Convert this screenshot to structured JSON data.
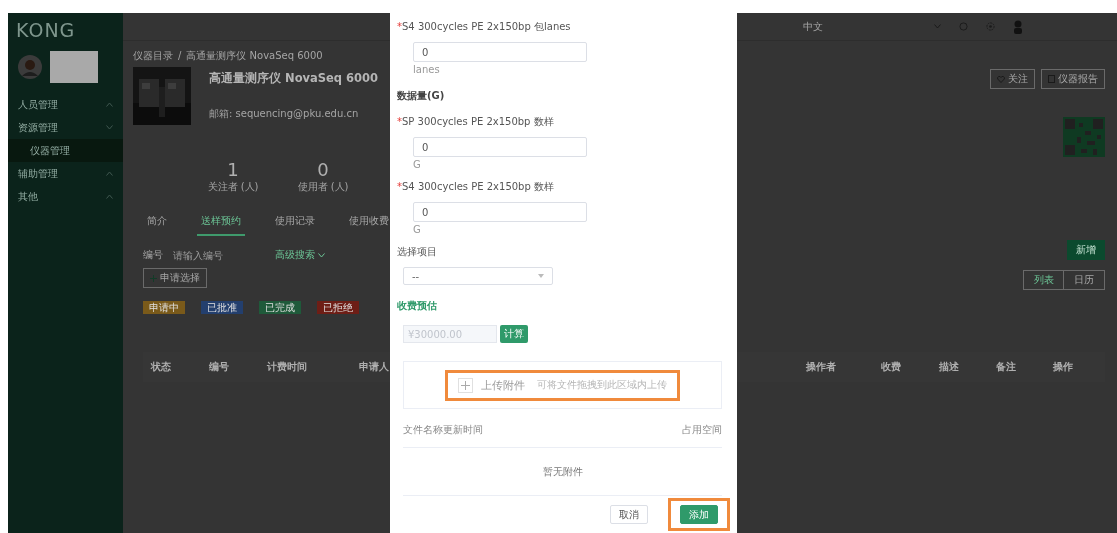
{
  "sidebar": {
    "logo": "KONG",
    "items": [
      {
        "label": "人员管理",
        "expanded": false,
        "selected": false
      },
      {
        "label": "资源管理",
        "expanded": true,
        "selected": false,
        "children": [
          {
            "label": "仪器管理",
            "selected": true
          }
        ]
      },
      {
        "label": "辅助管理",
        "expanded": false,
        "selected": false
      },
      {
        "label": "其他",
        "expanded": false,
        "selected": false
      }
    ]
  },
  "header": {
    "language": "中文"
  },
  "device": {
    "breadcrumb": [
      "仪器目录",
      "/",
      "高通量测序仪 NovaSeq 6000"
    ],
    "title": "高通量测序仪 NovaSeq 6000",
    "email": "邮箱: sequencing@pku.edu.cn",
    "stats": [
      {
        "value": "1",
        "label": "关注者 (人)"
      },
      {
        "value": "0",
        "label": "使用者 (人)"
      }
    ],
    "actions": [
      "关注",
      "仪器报告"
    ]
  },
  "tabs": [
    {
      "label": "简介",
      "selected": false
    },
    {
      "label": "送样预约",
      "selected": true
    },
    {
      "label": "使用记录",
      "selected": false
    },
    {
      "label": "使用收费",
      "selected": false
    }
  ],
  "filter": {
    "label": "编号",
    "placeholder": "请输入编号",
    "advanced": "高级搜索"
  },
  "batch_button": "申请选择",
  "status_tags": [
    {
      "label": "申请中",
      "color": "#7a5a1a"
    },
    {
      "label": "已批准",
      "color": "#233f6e"
    },
    {
      "label": "已完成",
      "color": "#1f5a3a"
    },
    {
      "label": "已拒绝",
      "color": "#6e1e16"
    }
  ],
  "new_button": "新增",
  "view_toggle": [
    {
      "label": "列表",
      "selected": true
    },
    {
      "label": "日历",
      "selected": false
    }
  ],
  "table": {
    "columns_left": [
      "状态",
      "编号",
      "计费时间",
      "申请人"
    ],
    "columns_right": [
      "操作者",
      "收费",
      "描述",
      "备注",
      "操作"
    ]
  },
  "modal": {
    "fields": [
      {
        "kind": "number",
        "required": "*",
        "label": "S4 300cycles PE 2x150bp 包lanes",
        "value": "0",
        "unit": "lanes"
      },
      {
        "kind": "section",
        "label": "数据量(G)"
      },
      {
        "kind": "number",
        "required": "*",
        "label": "SP 300cycles PE 2x150bp 数样",
        "value": "0",
        "unit": "G"
      },
      {
        "kind": "number",
        "required": "*",
        "label": "S4 300cycles PE 2x150bp 数样",
        "value": "0",
        "unit": "G"
      },
      {
        "kind": "select",
        "label": "选择项目",
        "value": "--"
      }
    ],
    "estimate": {
      "title": "收费预估",
      "placeholder": "¥30000.00",
      "button": "计算"
    },
    "upload": {
      "button": "上传附件",
      "hint": "可将文件拖拽到此区域内上传",
      "highlighted": true
    },
    "files": {
      "columns": [
        "文件名称更新时间",
        "占用空间"
      ],
      "empty": "暂无附件"
    },
    "buttons": [
      {
        "label": "取消",
        "primary": false,
        "highlighted": false
      },
      {
        "label": "添加",
        "primary": true,
        "highlighted": true
      }
    ]
  }
}
